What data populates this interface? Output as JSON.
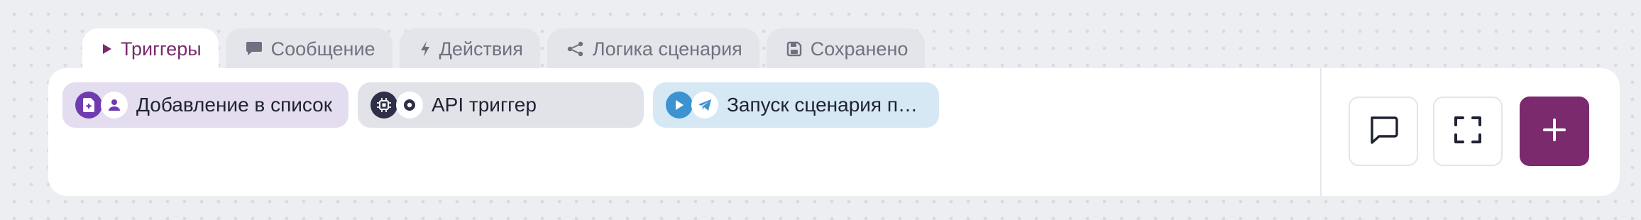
{
  "tabs": [
    {
      "label": "Триггеры",
      "icon": "play-icon",
      "active": true
    },
    {
      "label": "Сообщение",
      "icon": "message-icon",
      "active": false
    },
    {
      "label": "Действия",
      "icon": "bolt-icon",
      "active": false
    },
    {
      "label": "Логика сценария",
      "icon": "share-nodes-icon",
      "active": false
    },
    {
      "label": "Сохранено",
      "icon": "save-icon",
      "active": false
    }
  ],
  "triggers": [
    {
      "label": "Добавление в список",
      "icons": [
        "add-to-list-icon",
        "user-icon"
      ]
    },
    {
      "label": "API триггер",
      "icons": [
        "api-chip-icon",
        "webhook-icon"
      ]
    },
    {
      "label": "Запуск сценария п…",
      "icons": [
        "play-circle-icon",
        "telegram-icon"
      ]
    }
  ],
  "colors": {
    "accent": "#7b2a6e",
    "active_tab_text": "#7a2b6e",
    "tab_background": "#e3e5ea",
    "chip_list": "#e4dcef",
    "chip_api": "#e2e3e8",
    "chip_launch": "#d5e8f4"
  },
  "actions": [
    {
      "name": "comment-button",
      "icon": "comment-icon"
    },
    {
      "name": "expand-button",
      "icon": "fullscreen-icon"
    },
    {
      "name": "add-button",
      "icon": "plus-icon"
    }
  ]
}
